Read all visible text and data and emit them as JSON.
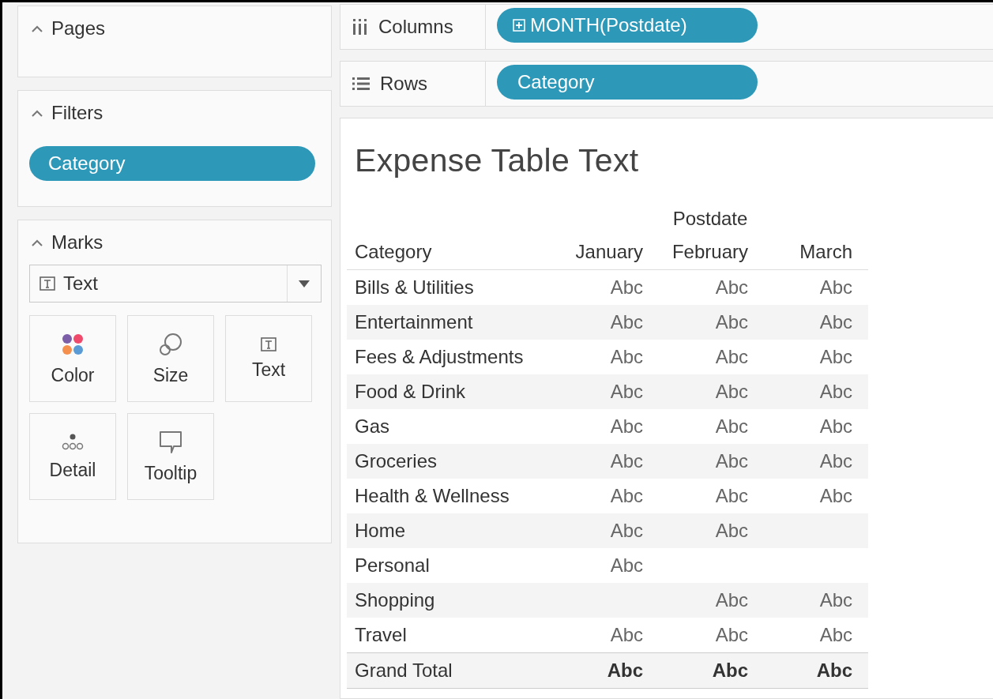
{
  "sidebar": {
    "pages": {
      "title": "Pages",
      "expanded": true
    },
    "filters": {
      "title": "Filters",
      "expanded": true,
      "pills": [
        "Category"
      ]
    },
    "marks": {
      "title": "Marks",
      "expanded": true,
      "mark_type": "Text",
      "cards": [
        {
          "kind": "color",
          "label": "Color"
        },
        {
          "kind": "size",
          "label": "Size"
        },
        {
          "kind": "text",
          "label": "Text"
        },
        {
          "kind": "detail",
          "label": "Detail"
        },
        {
          "kind": "tooltip",
          "label": "Tooltip"
        }
      ]
    }
  },
  "shelves": [
    {
      "kind": "columns",
      "label": "Columns",
      "pill": "MONTH(Postdate)",
      "expandable": true
    },
    {
      "kind": "rows",
      "label": "Rows",
      "pill": "Category",
      "expandable": false
    }
  ],
  "view": {
    "title": "Expense Table Text",
    "column_group": "Postdate",
    "row_header": "Category",
    "columns": [
      "January",
      "February",
      "March"
    ],
    "rows": [
      {
        "kind": "data",
        "label": "Bills & Utilities",
        "cells": [
          "Abc",
          "Abc",
          "Abc"
        ]
      },
      {
        "kind": "data",
        "label": "Entertainment",
        "cells": [
          "Abc",
          "Abc",
          "Abc"
        ]
      },
      {
        "kind": "data",
        "label": "Fees & Adjustments",
        "cells": [
          "Abc",
          "Abc",
          "Abc"
        ]
      },
      {
        "kind": "data",
        "label": "Food & Drink",
        "cells": [
          "Abc",
          "Abc",
          "Abc"
        ]
      },
      {
        "kind": "data",
        "label": "Gas",
        "cells": [
          "Abc",
          "Abc",
          "Abc"
        ]
      },
      {
        "kind": "data",
        "label": "Groceries",
        "cells": [
          "Abc",
          "Abc",
          "Abc"
        ]
      },
      {
        "kind": "data",
        "label": "Health & Wellness",
        "cells": [
          "Abc",
          "Abc",
          "Abc"
        ]
      },
      {
        "kind": "data",
        "label": "Home",
        "cells": [
          "Abc",
          "Abc",
          null
        ]
      },
      {
        "kind": "data",
        "label": "Personal",
        "cells": [
          "Abc",
          null,
          null
        ]
      },
      {
        "kind": "data",
        "label": "Shopping",
        "cells": [
          null,
          "Abc",
          "Abc"
        ]
      },
      {
        "kind": "data",
        "label": "Travel",
        "cells": [
          "Abc",
          "Abc",
          "Abc"
        ]
      },
      {
        "kind": "total",
        "label": "Grand Total",
        "cells": [
          "Abc",
          "Abc",
          "Abc"
        ]
      }
    ]
  }
}
